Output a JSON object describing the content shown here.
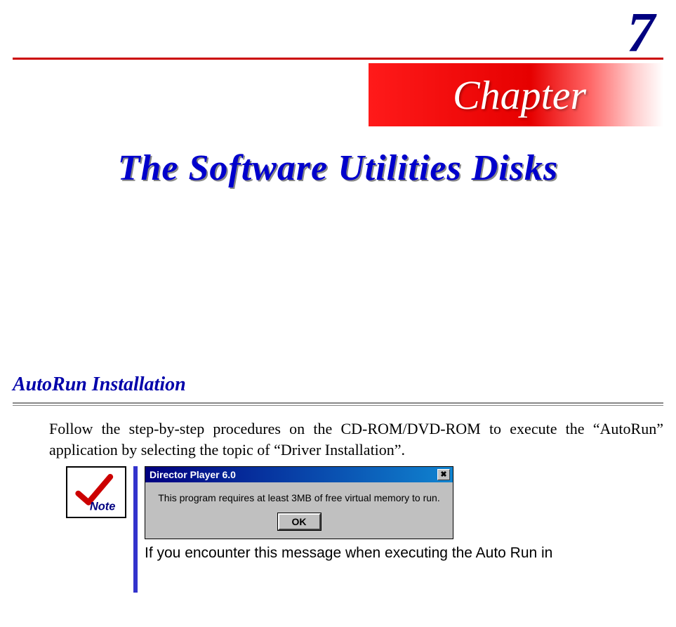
{
  "chapter": {
    "number": "7",
    "label": "Chapter"
  },
  "title": "The Software Utilities Disks",
  "section": {
    "heading": "AutoRun Installation",
    "body": "Follow the step-by-step procedures on the CD-ROM/DVD-ROM to execute the “AutoRun” application by selecting the topic of “Driver Installation”."
  },
  "note": {
    "icon_label": "Note",
    "caption": "If you encounter this message when executing the Auto Run  in"
  },
  "dialog": {
    "title": "Director Player 6.0",
    "close_symbol": "✖",
    "message": "This program requires at least 3MB of free virtual memory to run.",
    "ok_label": "OK"
  }
}
